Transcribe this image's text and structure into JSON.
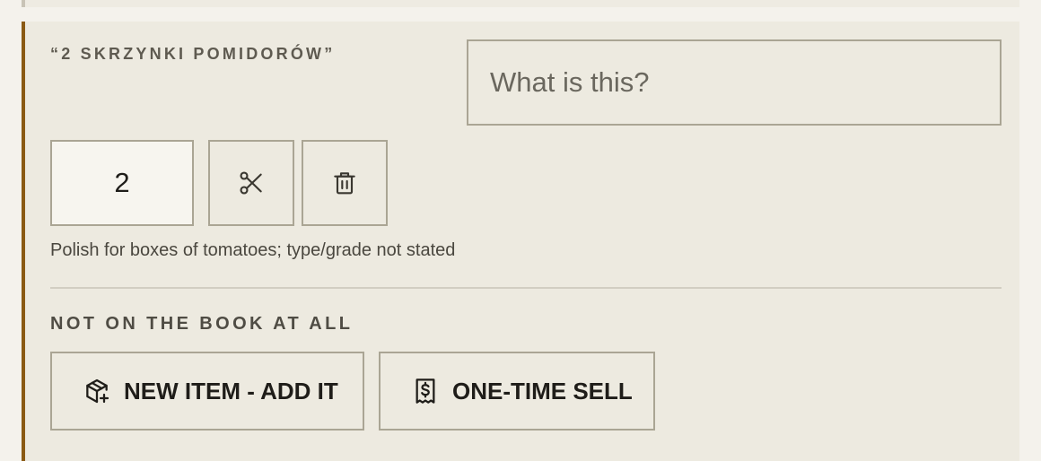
{
  "item": {
    "quoted_name": "“2 SKRZYNKI POMIDORÓW”",
    "description_placeholder": "What is this?",
    "quantity": "2",
    "note": "Polish for boxes of tomatoes; type/grade not stated"
  },
  "icons": {
    "split": "scissors-icon",
    "delete": "trash-icon",
    "new_item": "package-plus-icon",
    "one_time": "receipt-dollar-icon"
  },
  "not_on_book": {
    "label": "NOT ON THE BOOK AT ALL",
    "new_item_label": "NEW ITEM - ADD IT",
    "one_time_label": "ONE-TIME SELL"
  },
  "colors": {
    "accent_border": "#8a5a14",
    "card_background": "#edeae0",
    "page_background": "#f4f2ec"
  }
}
